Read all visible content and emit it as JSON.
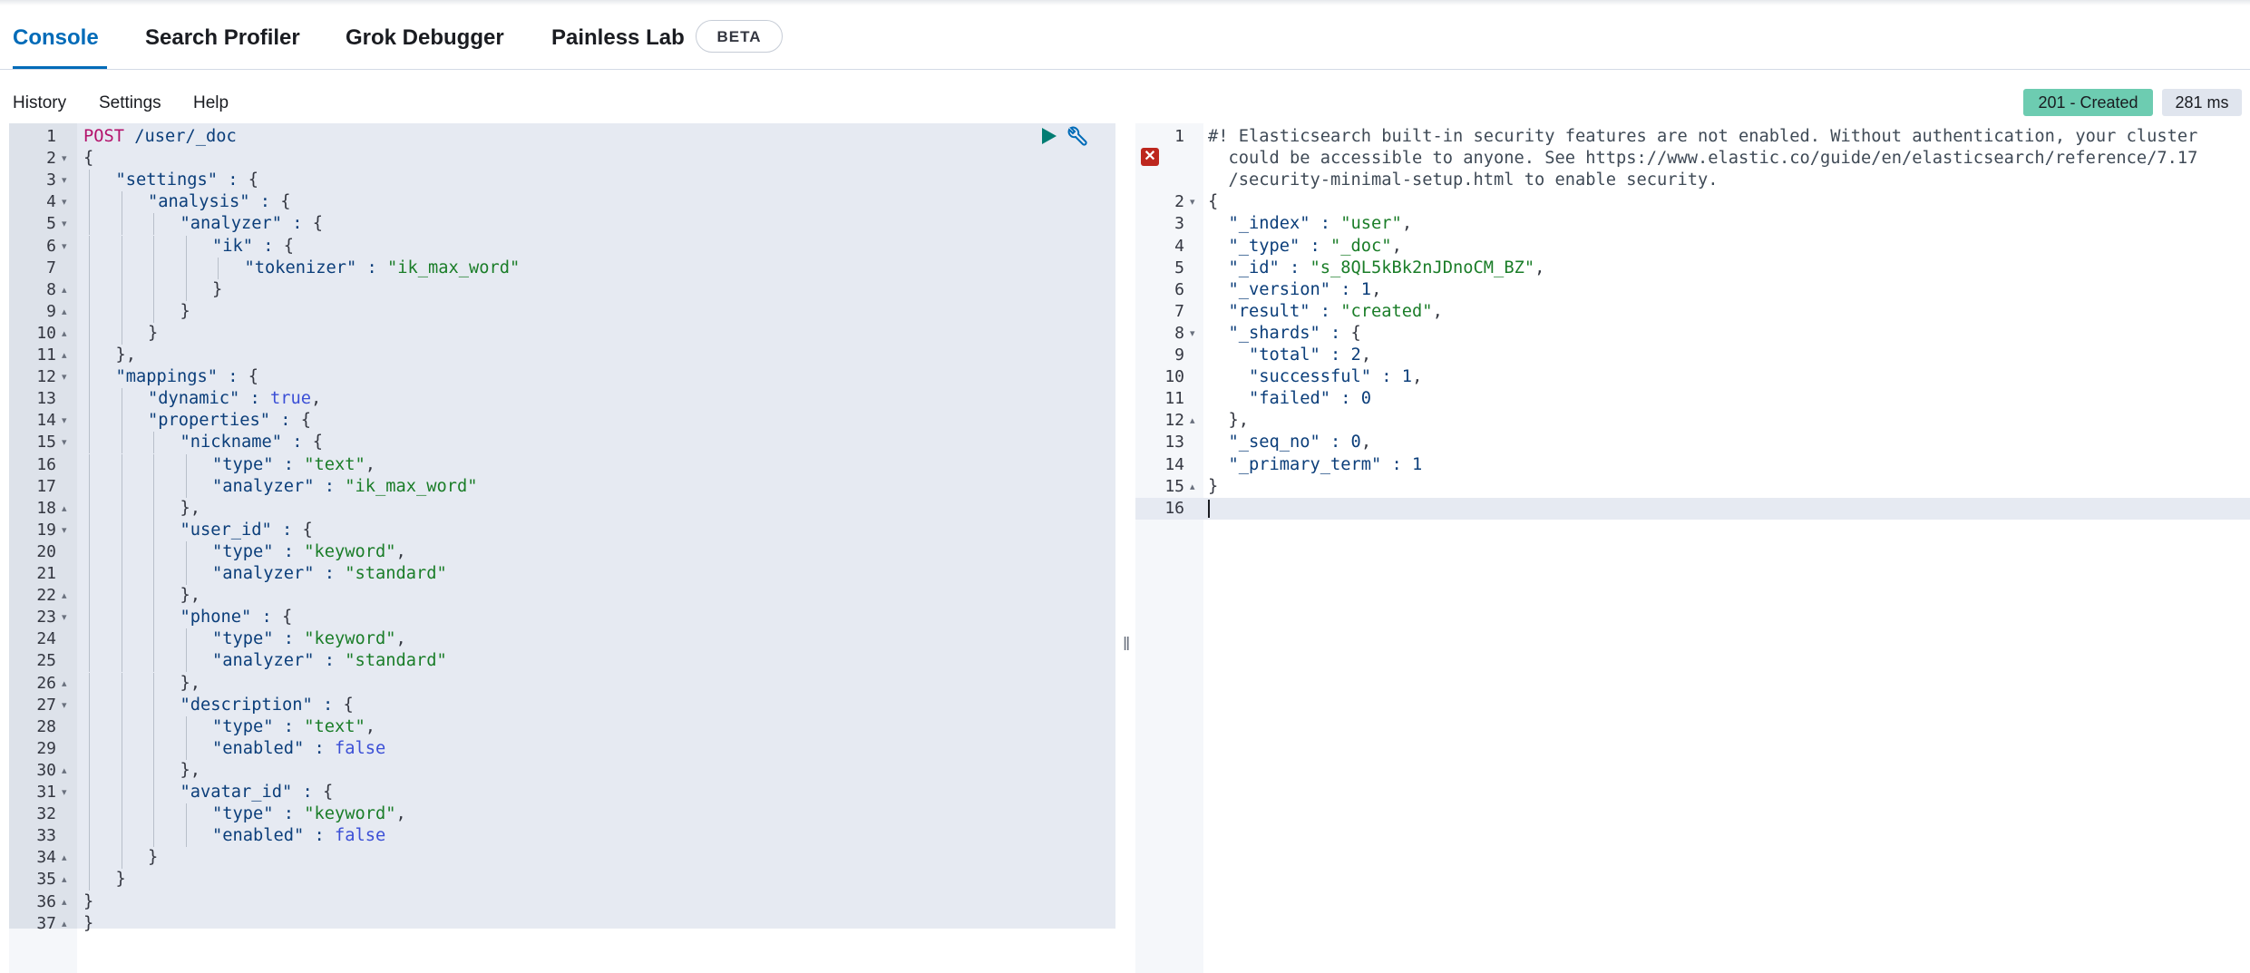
{
  "tabs": [
    {
      "label": "Console"
    },
    {
      "label": "Search Profiler"
    },
    {
      "label": "Grok Debugger"
    },
    {
      "label": "Painless Lab"
    }
  ],
  "beta_badge": "BETA",
  "menu": {
    "history": "History",
    "settings": "Settings",
    "help": "Help"
  },
  "response_status": "201 - Created",
  "response_time": "281 ms",
  "colors": {
    "accent": "#006bb8",
    "status_ok": "#6dccb1",
    "selection": "#e6eaf2",
    "run": "#017d73"
  },
  "request_lines": [
    {
      "n": "1",
      "fold": "",
      "indent": 0,
      "text": "POST /user/_doc",
      "kind": "method"
    },
    {
      "n": "2",
      "fold": "▾",
      "indent": 0,
      "text": "{",
      "kind": "p"
    },
    {
      "n": "3",
      "fold": "▾",
      "indent": 1,
      "text": "\"settings\" : {",
      "kind": "kv"
    },
    {
      "n": "4",
      "fold": "▾",
      "indent": 2,
      "text": "\"analysis\" : {",
      "kind": "kv"
    },
    {
      "n": "5",
      "fold": "▾",
      "indent": 3,
      "text": "\"analyzer\" : {",
      "kind": "kv"
    },
    {
      "n": "6",
      "fold": "▾",
      "indent": 4,
      "text": "\"ik\" : {",
      "kind": "kv"
    },
    {
      "n": "7",
      "fold": "",
      "indent": 5,
      "text": "\"tokenizer\" : \"ik_max_word\"",
      "kind": "kv"
    },
    {
      "n": "8",
      "fold": "▴",
      "indent": 4,
      "text": "}",
      "kind": "p"
    },
    {
      "n": "9",
      "fold": "▴",
      "indent": 3,
      "text": "}",
      "kind": "p"
    },
    {
      "n": "10",
      "fold": "▴",
      "indent": 2,
      "text": "}",
      "kind": "p"
    },
    {
      "n": "11",
      "fold": "▴",
      "indent": 1,
      "text": "},",
      "kind": "p"
    },
    {
      "n": "12",
      "fold": "▾",
      "indent": 1,
      "text": "\"mappings\" : {",
      "kind": "kv"
    },
    {
      "n": "13",
      "fold": "",
      "indent": 2,
      "text": "\"dynamic\" : true,",
      "kind": "kv"
    },
    {
      "n": "14",
      "fold": "▾",
      "indent": 2,
      "text": "\"properties\" : {",
      "kind": "kv"
    },
    {
      "n": "15",
      "fold": "▾",
      "indent": 3,
      "text": "\"nickname\" : {",
      "kind": "kv"
    },
    {
      "n": "16",
      "fold": "",
      "indent": 4,
      "text": "\"type\" : \"text\",",
      "kind": "kv"
    },
    {
      "n": "17",
      "fold": "",
      "indent": 4,
      "text": "\"analyzer\" : \"ik_max_word\"",
      "kind": "kv"
    },
    {
      "n": "18",
      "fold": "▴",
      "indent": 3,
      "text": "},",
      "kind": "p"
    },
    {
      "n": "19",
      "fold": "▾",
      "indent": 3,
      "text": "\"user_id\" : {",
      "kind": "kv"
    },
    {
      "n": "20",
      "fold": "",
      "indent": 4,
      "text": "\"type\" : \"keyword\",",
      "kind": "kv"
    },
    {
      "n": "21",
      "fold": "",
      "indent": 4,
      "text": "\"analyzer\" : \"standard\"",
      "kind": "kv"
    },
    {
      "n": "22",
      "fold": "▴",
      "indent": 3,
      "text": "},",
      "kind": "p"
    },
    {
      "n": "23",
      "fold": "▾",
      "indent": 3,
      "text": "\"phone\" : {",
      "kind": "kv"
    },
    {
      "n": "24",
      "fold": "",
      "indent": 4,
      "text": "\"type\" : \"keyword\",",
      "kind": "kv"
    },
    {
      "n": "25",
      "fold": "",
      "indent": 4,
      "text": "\"analyzer\" : \"standard\"",
      "kind": "kv"
    },
    {
      "n": "26",
      "fold": "▴",
      "indent": 3,
      "text": "},",
      "kind": "p"
    },
    {
      "n": "27",
      "fold": "▾",
      "indent": 3,
      "text": "\"description\" : {",
      "kind": "kv"
    },
    {
      "n": "28",
      "fold": "",
      "indent": 4,
      "text": "\"type\" : \"text\",",
      "kind": "kv"
    },
    {
      "n": "29",
      "fold": "",
      "indent": 4,
      "text": "\"enabled\" : false",
      "kind": "kv"
    },
    {
      "n": "30",
      "fold": "▴",
      "indent": 3,
      "text": "},",
      "kind": "p"
    },
    {
      "n": "31",
      "fold": "▾",
      "indent": 3,
      "text": "\"avatar_id\" : {",
      "kind": "kv"
    },
    {
      "n": "32",
      "fold": "",
      "indent": 4,
      "text": "\"type\" : \"keyword\",",
      "kind": "kv"
    },
    {
      "n": "33",
      "fold": "",
      "indent": 4,
      "text": "\"enabled\" : false",
      "kind": "kv"
    },
    {
      "n": "34",
      "fold": "▴",
      "indent": 2,
      "text": "}",
      "kind": "p"
    },
    {
      "n": "35",
      "fold": "▴",
      "indent": 1,
      "text": "}",
      "kind": "p"
    },
    {
      "n": "36",
      "fold": "▴",
      "indent": 0,
      "text": "}",
      "kind": "p"
    },
    {
      "n": "37",
      "fold": "▴",
      "indent": 0,
      "text": "}",
      "kind": "p"
    }
  ],
  "response_lines": [
    {
      "n": "1",
      "fold": "",
      "text": "#! Elasticsearch built-in security features are not enabled. Without authentication, your cluster",
      "kind": "comment"
    },
    {
      "n": "",
      "fold": "",
      "text": "  could be accessible to anyone. See https://www.elastic.co/guide/en/elasticsearch/reference/7.17",
      "kind": "comment"
    },
    {
      "n": "",
      "fold": "",
      "text": "  /security-minimal-setup.html to enable security.",
      "kind": "comment"
    },
    {
      "n": "2",
      "fold": "▾",
      "text": "{",
      "kind": "p"
    },
    {
      "n": "3",
      "fold": "",
      "text": "  \"_index\" : \"user\",",
      "kind": "kv"
    },
    {
      "n": "4",
      "fold": "",
      "text": "  \"_type\" : \"_doc\",",
      "kind": "kv"
    },
    {
      "n": "5",
      "fold": "",
      "text": "  \"_id\" : \"s_8QL5kBk2nJDnoCM_BZ\",",
      "kind": "kv"
    },
    {
      "n": "6",
      "fold": "",
      "text": "  \"_version\" : 1,",
      "kind": "kv"
    },
    {
      "n": "7",
      "fold": "",
      "text": "  \"result\" : \"created\",",
      "kind": "kv"
    },
    {
      "n": "8",
      "fold": "▾",
      "text": "  \"_shards\" : {",
      "kind": "kv"
    },
    {
      "n": "9",
      "fold": "",
      "text": "    \"total\" : 2,",
      "kind": "kv"
    },
    {
      "n": "10",
      "fold": "",
      "text": "    \"successful\" : 1,",
      "kind": "kv"
    },
    {
      "n": "11",
      "fold": "",
      "text": "    \"failed\" : 0",
      "kind": "kv"
    },
    {
      "n": "12",
      "fold": "▴",
      "text": "  },",
      "kind": "p"
    },
    {
      "n": "13",
      "fold": "",
      "text": "  \"_seq_no\" : 0,",
      "kind": "kv"
    },
    {
      "n": "14",
      "fold": "",
      "text": "  \"_primary_term\" : 1",
      "kind": "kv"
    },
    {
      "n": "15",
      "fold": "▴",
      "text": "}",
      "kind": "p"
    },
    {
      "n": "16",
      "fold": "",
      "text": "",
      "kind": "p"
    }
  ]
}
